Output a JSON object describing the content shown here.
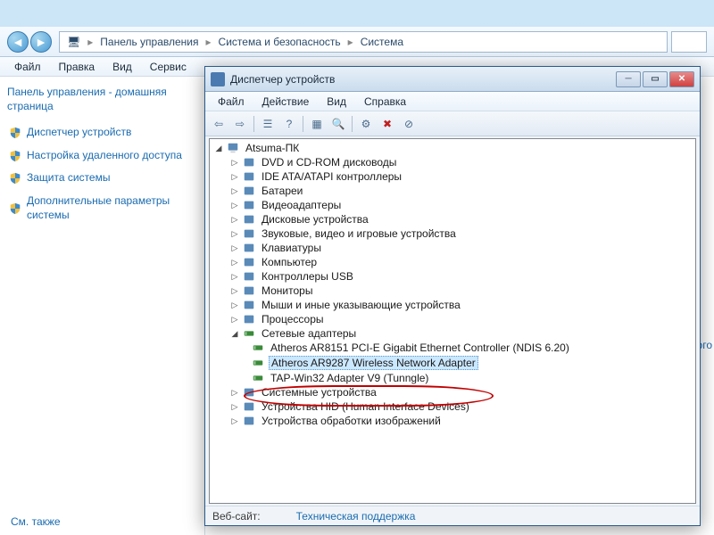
{
  "breadcrumb": {
    "items": [
      "Панель управления",
      "Система и безопасность",
      "Система"
    ]
  },
  "explorer_menu": [
    "Файл",
    "Правка",
    "Вид",
    "Сервис"
  ],
  "sidebar": {
    "title": "Панель управления - домашняя страница",
    "items": [
      "Диспетчер устройств",
      "Настройка удаленного доступа",
      "Защита системы",
      "Дополнительные параметры системы"
    ],
    "see_also": "См. также"
  },
  "right_text": "а для этого",
  "devmgr": {
    "title": "Диспетчер устройств",
    "menu": [
      "Файл",
      "Действие",
      "Вид",
      "Справка"
    ],
    "root": "Atsuma-ПК",
    "categories": [
      "DVD и CD-ROM дисководы",
      "IDE ATA/ATAPI контроллеры",
      "Батареи",
      "Видеоадаптеры",
      "Дисковые устройства",
      "Звуковые, видео и игровые устройства",
      "Клавиатуры",
      "Компьютер",
      "Контроллеры USB",
      "Мониторы",
      "Мыши и иные указывающие устройства",
      "Процессоры"
    ],
    "network": {
      "label": "Сетевые адаптеры",
      "items": [
        "Atheros AR8151 PCI-E Gigabit Ethernet Controller (NDIS 6.20)",
        "Atheros AR9287 Wireless Network Adapter",
        "TAP-Win32 Adapter V9 (Tunngle)"
      ]
    },
    "tail": [
      "Системные устройства",
      "Устройства HID (Human Interface Devices)",
      "Устройства обработки изображений"
    ],
    "status_label": "Веб-сайт:",
    "status_link": "Техническая поддержка"
  }
}
